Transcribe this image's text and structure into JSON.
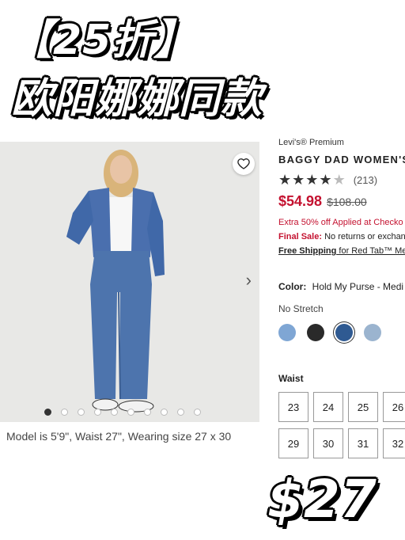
{
  "overlay": {
    "headline_1": "【25折】",
    "headline_2": "欧阳娜娜同款",
    "price_big": "$27"
  },
  "gallery": {
    "caption": "Model is 5'9\", Waist 27\", Wearing size 27 x 30",
    "dots_total": 10,
    "active_dot": 0
  },
  "product": {
    "brand": "Levi's® Premium",
    "title": "BAGGY DAD WOMEN'S",
    "rating": 4.5,
    "review_count": "(213)",
    "price_now": "$54.98",
    "price_was": "$108.00",
    "promo": "Extra 50% off Applied at Checko",
    "final_label": "Final Sale:",
    "final_text": " No returns or exchange",
    "ship_label": "Free Shipping",
    "ship_text": " for Red Tab™ Mem",
    "color_label": "Color:",
    "color_value": "Hold My Purse - Medi",
    "stretch": "No Stretch",
    "swatches": [
      "#7fa6d4",
      "#2a2a2a",
      "#2f5a92",
      "#9bb4cf"
    ],
    "selected_swatch": 2,
    "waist_label": "Waist",
    "sizes": [
      "23",
      "24",
      "25",
      "26",
      "29",
      "30",
      "31",
      "32"
    ]
  }
}
